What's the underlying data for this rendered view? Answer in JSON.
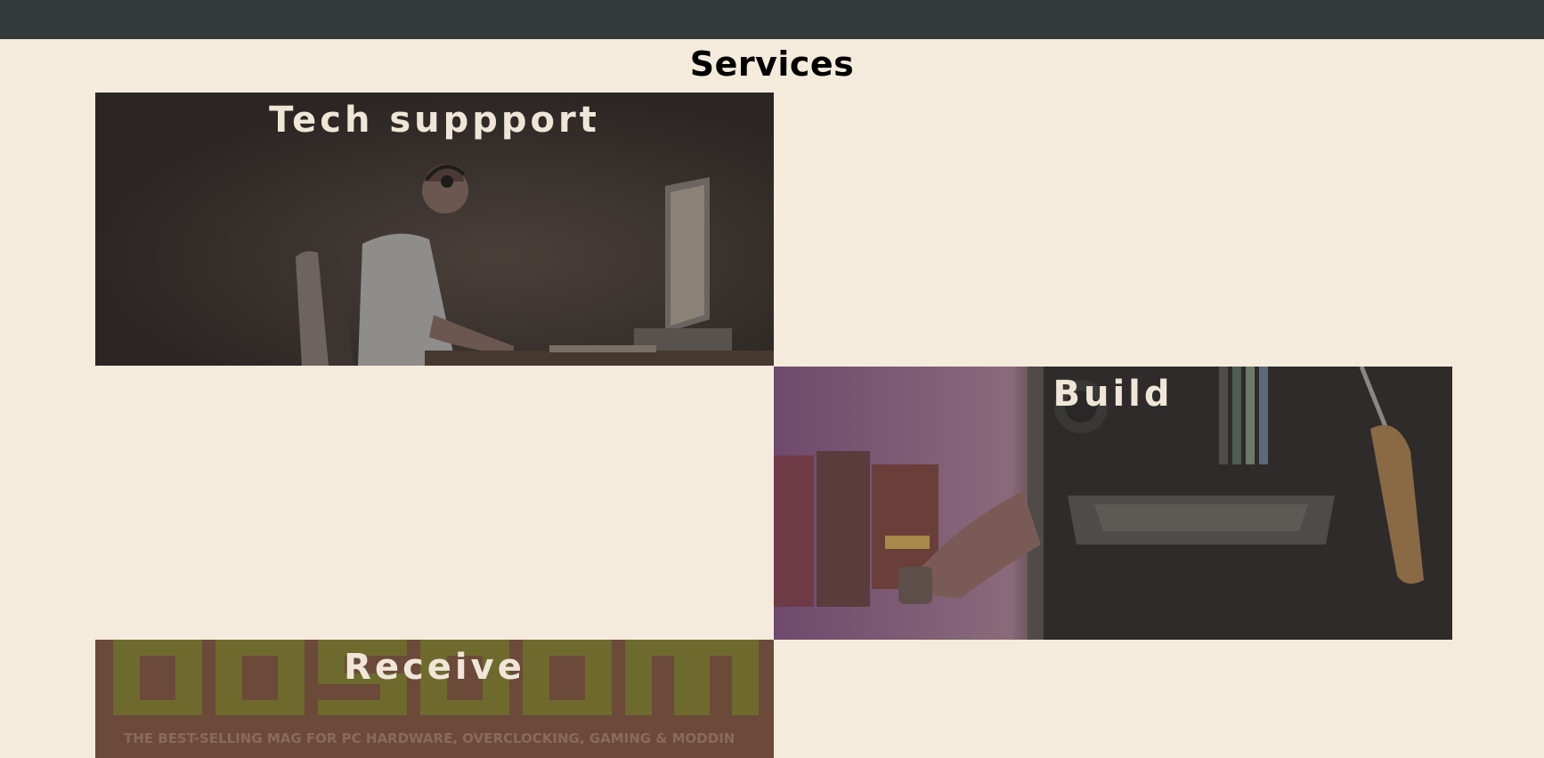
{
  "header": {},
  "section": {
    "title": "Services"
  },
  "cards": [
    {
      "title": "Tech suppport"
    },
    {
      "title": "Build"
    },
    {
      "title": "Receive",
      "image_caption": "THE BEST-SELLING MAG FOR PC HARDWARE, OVERCLOCKING, GAMING & MODDIN"
    }
  ],
  "colors": {
    "background": "#f5ebdc",
    "topbar": "#353a3b",
    "card_title": "#f0e6d8"
  }
}
